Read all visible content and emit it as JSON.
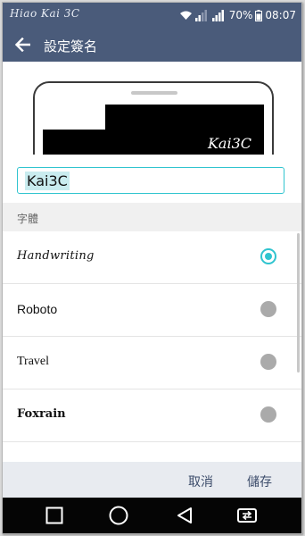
{
  "status_bar": {
    "watermark": "Hiao Kai 3C",
    "battery": "70%",
    "time": "08:07",
    "icons": [
      "wifi-icon",
      "signal-icon",
      "signal-icon",
      "battery-icon"
    ]
  },
  "header": {
    "title": "設定簽名",
    "back_icon": "arrow-left-icon"
  },
  "preview": {
    "signature_text": "Kai3C"
  },
  "input": {
    "value": "Kai3C"
  },
  "font_section": {
    "header": "字體",
    "fonts": [
      {
        "label": "Handwriting",
        "selected": true
      },
      {
        "label": "Roboto",
        "selected": false
      },
      {
        "label": "Travel",
        "selected": false
      },
      {
        "label": "Foxrain",
        "selected": false
      }
    ]
  },
  "actions": {
    "cancel": "取消",
    "save": "儲存"
  },
  "nav_bar": {
    "icons": [
      "square-icon",
      "circle-icon",
      "triangle-icon",
      "switch-sim-icon"
    ]
  },
  "colors": {
    "header": "#4a5b7a",
    "accent": "#30c4cf",
    "action_text": "#3d4d6b"
  }
}
